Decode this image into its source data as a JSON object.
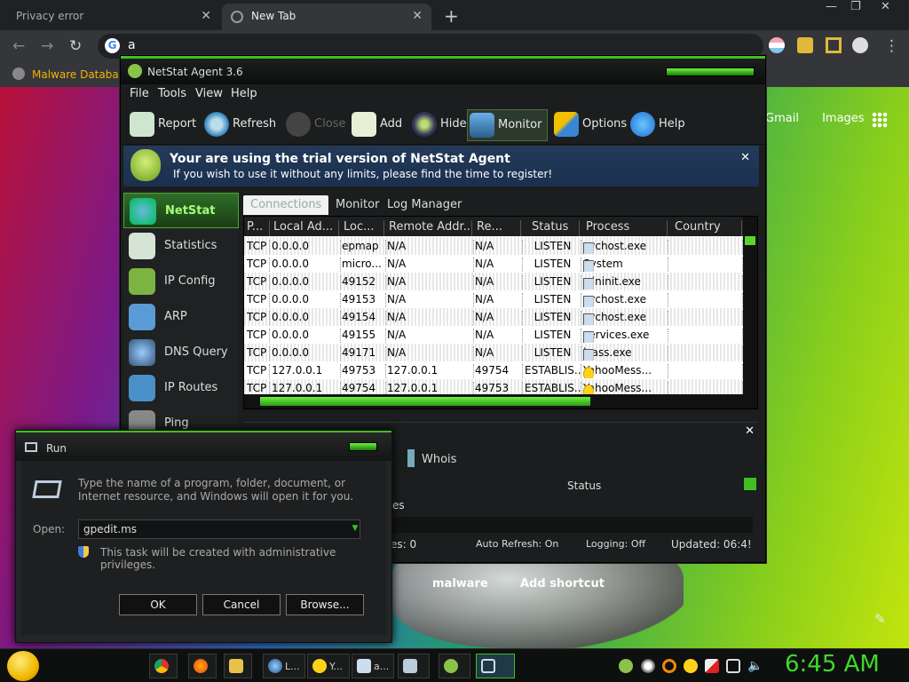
{
  "browser": {
    "tabs": [
      {
        "title": "Privacy error",
        "close": "✕"
      },
      {
        "title": "New Tab",
        "close": "✕"
      }
    ],
    "new_tab": "+",
    "window_controls": {
      "min": "—",
      "max": "❐",
      "close": "✕"
    },
    "omnibox_value": "a",
    "omnibox_icon": "G",
    "bookmark": "Malware Databas",
    "google_links": [
      "Gmail",
      "Images"
    ],
    "shortcuts": [
      "malware",
      "Add shortcut"
    ]
  },
  "netstat": {
    "title": "NetStat Agent 3.6",
    "menu": [
      "File",
      "Tools",
      "View",
      "Help"
    ],
    "toolbar": [
      "Report",
      "Refresh",
      "Close",
      "Add",
      "Hide",
      "Monitor",
      "Options",
      "Help"
    ],
    "trial_title": "Your are using the trial version of NetStat Agent",
    "trial_text": "If you wish to use it without any limits, please find the time to register!",
    "close_x": "✕",
    "sidebar": [
      "NetStat",
      "Statistics",
      "IP Config",
      "ARP",
      "DNS Query",
      "IP Routes",
      "Ping"
    ],
    "tabs": [
      "Connections",
      "Monitor",
      "Log Manager"
    ],
    "columns": [
      "P...",
      "Local Ad...",
      "Loc...",
      "Remote Addr...",
      "Re...",
      "Status",
      "Process",
      "Country"
    ],
    "rows": [
      [
        "TCP",
        "0.0.0.0",
        "epmap",
        "N/A",
        "N/A",
        "LISTEN",
        "svchost.exe",
        ""
      ],
      [
        "TCP",
        "0.0.0.0",
        "micro...",
        "N/A",
        "N/A",
        "LISTEN",
        "System",
        ""
      ],
      [
        "TCP",
        "0.0.0.0",
        "49152",
        "N/A",
        "N/A",
        "LISTEN",
        "wininit.exe",
        ""
      ],
      [
        "TCP",
        "0.0.0.0",
        "49153",
        "N/A",
        "N/A",
        "LISTEN",
        "svchost.exe",
        ""
      ],
      [
        "TCP",
        "0.0.0.0",
        "49154",
        "N/A",
        "N/A",
        "LISTEN",
        "svchost.exe",
        ""
      ],
      [
        "TCP",
        "0.0.0.0",
        "49155",
        "N/A",
        "N/A",
        "LISTEN",
        "services.exe",
        ""
      ],
      [
        "TCP",
        "0.0.0.0",
        "49171",
        "N/A",
        "N/A",
        "LISTEN",
        "lsass.exe",
        ""
      ],
      [
        "TCP",
        "127.0.0.1",
        "49753",
        "127.0.0.1",
        "49754",
        "ESTABLIS...",
        "YahooMess...",
        ""
      ],
      [
        "TCP",
        "127.0.0.1",
        "49754",
        "127.0.0.1",
        "49753",
        "ESTABLIS...",
        "YahooMess...",
        ""
      ]
    ],
    "lower": {
      "whois": "Whois",
      "status": "Status",
      "es": "es"
    },
    "statusbar": {
      "connections": "es: 0",
      "auto_refresh": "Auto Refresh: On",
      "logging": "Logging: Off",
      "updated": "Updated: 06:4!"
    }
  },
  "run": {
    "title": "Run",
    "description": "Type the name of a program, folder, document, or Internet resource, and Windows will open it for you.",
    "open_label": "Open:",
    "input_value": "gpedit.ms",
    "admin_note": "This task will be created with administrative privileges.",
    "ok": "OK",
    "cancel": "Cancel",
    "browse": "Browse..."
  },
  "taskbar": {
    "items": [
      {
        "label": "",
        "icon": "chrome-icon"
      },
      {
        "label": "",
        "icon": "firefox-icon"
      },
      {
        "label": "",
        "icon": "folder-icon"
      },
      {
        "label": "L...",
        "icon": "network-icon"
      },
      {
        "label": "Y...",
        "icon": "yahoo-icon"
      },
      {
        "label": "a...",
        "icon": "notepad-icon"
      },
      {
        "label": "",
        "icon": "network-tool-icon"
      },
      {
        "label": "",
        "icon": "netstat-icon"
      },
      {
        "label": "",
        "icon": "run-icon"
      }
    ],
    "clock": "6:45 AM"
  }
}
